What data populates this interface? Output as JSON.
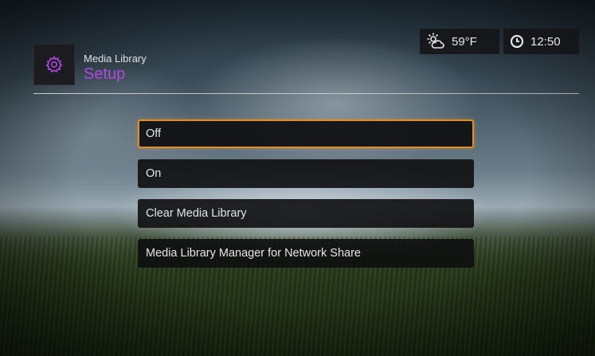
{
  "header": {
    "app_title": "Media Library",
    "page_title": "Setup",
    "icon": "gear-icon",
    "accent_color": "#b04ae0"
  },
  "status": {
    "weather_icon": "partly-cloudy-icon",
    "temperature": "59°F",
    "clock_icon": "clock-icon",
    "time": "12:50"
  },
  "menu": {
    "selection_color": "#e0902a",
    "items": [
      {
        "label": "Off",
        "selected": true
      },
      {
        "label": "On",
        "selected": false
      },
      {
        "label": "Clear Media Library",
        "selected": false
      },
      {
        "label": "Media Library Manager for Network Share",
        "selected": false
      }
    ]
  }
}
